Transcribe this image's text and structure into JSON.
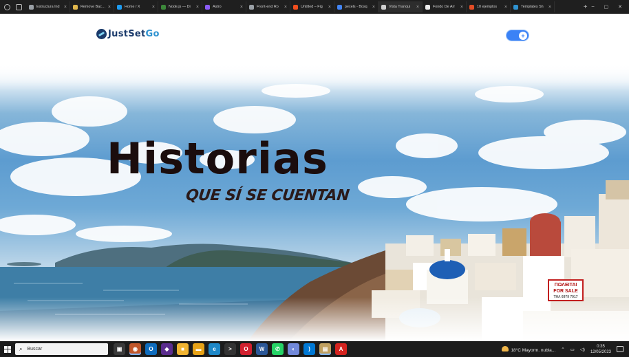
{
  "browser": {
    "tabs": [
      {
        "label": "Estructura Ind",
        "color": "#9aa0a6",
        "active": false
      },
      {
        "label": "Remove Backgr",
        "color": "#e0b64c",
        "active": false
      },
      {
        "label": "Home / X",
        "color": "#1d9bf0",
        "active": false
      },
      {
        "label": "Node.js — Di",
        "color": "#3c873a",
        "active": false
      },
      {
        "label": "Astro",
        "color": "#8b5cf6",
        "active": false
      },
      {
        "label": "Front-end Ro",
        "color": "#9aa0a6",
        "active": false
      },
      {
        "label": "Untitled – Fig",
        "color": "#f24e1e",
        "active": false
      },
      {
        "label": "pexels - Búsq",
        "color": "#4285f4",
        "active": false
      },
      {
        "label": "Vista Tranqui",
        "color": "#cfcfcf",
        "active": true
      },
      {
        "label": "Fondo De Arr",
        "color": "#eeeeee",
        "active": false
      },
      {
        "label": "10 ejemplos",
        "color": "#e44d26",
        "active": false
      },
      {
        "label": "Templates Sh",
        "color": "#2f93d1",
        "active": false
      }
    ],
    "new_tab": "+",
    "controls": [
      "–",
      "▢",
      "✕"
    ]
  },
  "site": {
    "logo_part1": "JustSet",
    "logo_part2": "Go",
    "toggle_icon": "+"
  },
  "hero": {
    "title": "Historias",
    "subtitle": "QUE SÍ SE CUENTAN",
    "sign_line1": "ΠΩΛΕΙΤΑΙ",
    "sign_line2": "FOR SALE",
    "sign_line3": "ΤΗΛ 6979 7917"
  },
  "taskbar": {
    "search_placeholder": "Buscar",
    "apps": [
      {
        "name": "task-view",
        "color": "#3a3a3a",
        "glyph": "▣"
      },
      {
        "name": "photos",
        "color": "#c2572a",
        "glyph": "◉"
      },
      {
        "name": "outlook",
        "color": "#0f6cbd",
        "glyph": "O"
      },
      {
        "name": "app-purple",
        "color": "#5b2d8e",
        "glyph": "◆"
      },
      {
        "name": "store",
        "color": "#f1b431",
        "glyph": "■"
      },
      {
        "name": "explorer",
        "color": "#e8a317",
        "glyph": "▬"
      },
      {
        "name": "edge",
        "color": "#1e88c8",
        "glyph": "e"
      },
      {
        "name": "terminal",
        "color": "#333333",
        "glyph": ">"
      },
      {
        "name": "opera",
        "color": "#d1202f",
        "glyph": "O"
      },
      {
        "name": "word",
        "color": "#2b5797",
        "glyph": "W"
      },
      {
        "name": "whatsapp",
        "color": "#25d366",
        "glyph": "✆"
      },
      {
        "name": "discord",
        "color": "#7289da",
        "glyph": "◐"
      },
      {
        "name": "vscode",
        "color": "#0078d4",
        "glyph": "⟩"
      },
      {
        "name": "notes",
        "color": "#c0a060",
        "glyph": "▤"
      },
      {
        "name": "acrobat",
        "color": "#d4231f",
        "glyph": "A"
      }
    ],
    "weather": "18°C  Mayorm. nubla...",
    "time": "0:35",
    "date": "12/05/2023"
  }
}
